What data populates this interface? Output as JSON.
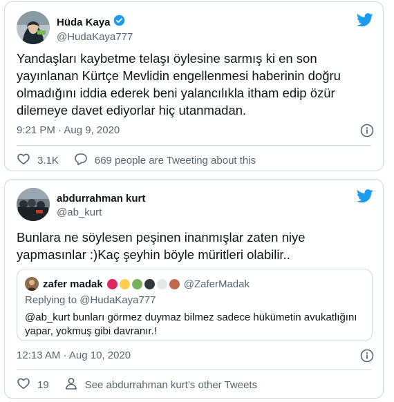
{
  "tweets": [
    {
      "name": "Hüda Kaya",
      "handle": "@HudaKaya777",
      "verified": true,
      "text": "Yandaşları kaybetme telaşı öylesine sarmış ki en son yayınlanan Kürtçe Mevlidin engellenmesi haberinin doğru olmadığını iddia ederek beni yalancılıkla itham edip özür dilemeye davet ediyorlar hiç utanmadan.",
      "time": "9:21 PM · Aug 9, 2020",
      "likes": "3.1K",
      "secondary_action": "669 people are Tweeting about this"
    },
    {
      "name": "abdurrahman kurt",
      "handle": "@ab_kurt",
      "text": "Bunlara ne söylesen peşinen inanmışlar zaten niye yapmasınlar :)Kaç şeyhin böyle müritleri olabilir..",
      "quote": {
        "name": "zafer madak",
        "handle": "@ZaferMadak",
        "emoji_dots": [
          "#e0245e",
          "#ffcc4d",
          "#78b159",
          "#31373d",
          "#e6e7e8",
          "#c1694f"
        ],
        "replying_to": "Replying to @HudaKaya777",
        "text": "@ab_kurt bunları görmez duymaz bilmez sadece hükümetin avukatlığını yapar, yokmuş gibi davranır.!"
      },
      "time": "12:13 AM · Aug 10, 2020",
      "likes": "19",
      "secondary_action": "See abdurrahman kurt's other Tweets"
    }
  ],
  "colors": {
    "twitter_blue": "#1d9bf0",
    "text_secondary": "#536471",
    "border": "#cfd9de"
  }
}
